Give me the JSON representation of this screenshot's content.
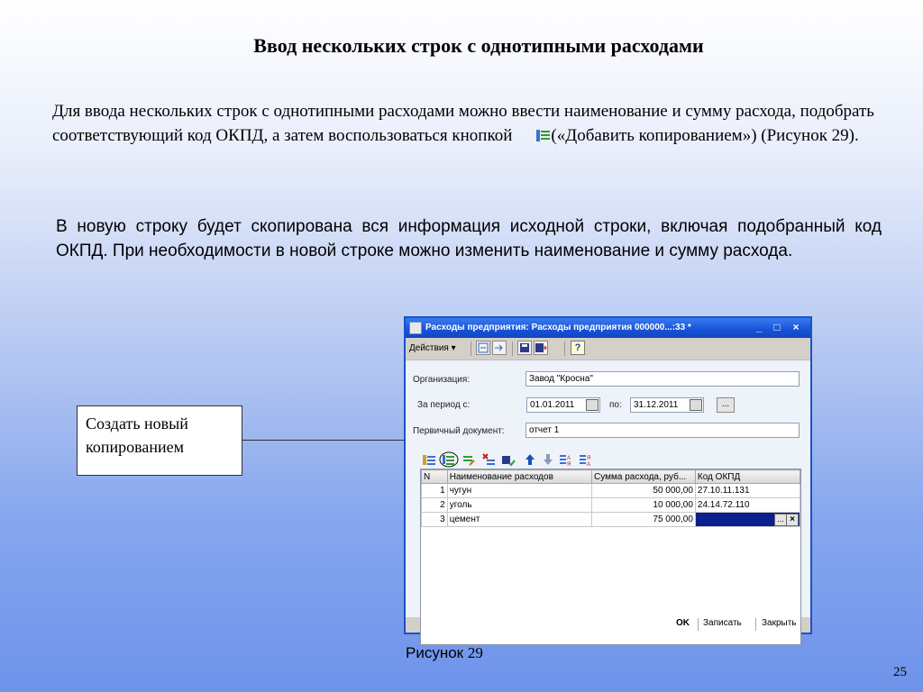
{
  "slide": {
    "title": "Ввод нескольких строк с однотипными расходами",
    "para1_a": "Для ввода нескольких строк с однотипными расходами можно ввести наименование и сумму расхода, подобрать соответствующий код ОКПД, а затем воспользоваться кнопкой",
    "para1_b": "(«Добавить копированием») (Рисунок 29).",
    "para2": "В новую строку будет скопирована вся информация исходной строки, включая подобранный код ОКПД. При необходимости в новой строке можно изменить наименование и сумму расхода.",
    "callout": "Создать новый копированием",
    "caption_word": "Рисунок",
    "caption_num": "29",
    "page_number": "25"
  },
  "window": {
    "title": "Расходы предприятия: Расходы предприятия 000000...:33 *",
    "title_buttons": [
      "_",
      "□",
      "×"
    ],
    "actions_label": "Действия ▾",
    "help_label": "?",
    "fields": {
      "org_label": "Организация:",
      "org_value": "Завод \"Кросна\"",
      "period_label": "За период с:",
      "period_from": "01.01.2011",
      "period_to_label": "по:",
      "period_to": "31.12.2011",
      "dots": "...",
      "doc_label": "Первичный документ:",
      "doc_value": "отчет 1"
    },
    "table": {
      "headers": [
        "N",
        "Наименование расходов",
        "Сумма расхода, руб...",
        "Код ОКПД"
      ],
      "rows": [
        {
          "n": "1",
          "name": "чугун",
          "sum": "50 000,00",
          "code": "27.10.11.131"
        },
        {
          "n": "2",
          "name": "уголь",
          "sum": "10 000,00",
          "code": "24.14.72.110"
        },
        {
          "n": "3",
          "name": "цемент",
          "sum": "75 000,00",
          "code": ""
        }
      ]
    },
    "buttons": {
      "ok": "OK",
      "save": "Записать",
      "close": "Закрыть"
    }
  },
  "colors": {
    "title_bar": "#1652d6",
    "selected_cell": "#0b1f8e",
    "accent_green": "#2e9e2e"
  }
}
